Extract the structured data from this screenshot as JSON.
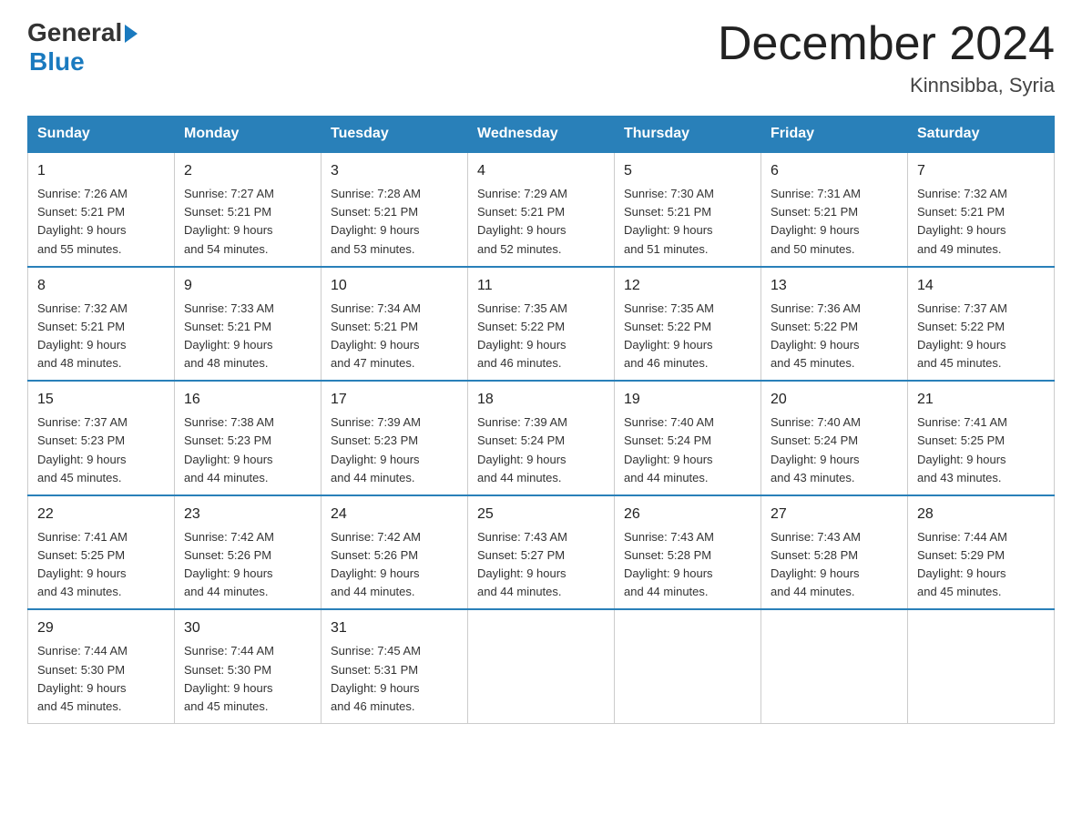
{
  "logo": {
    "general": "General",
    "blue": "Blue"
  },
  "title": "December 2024",
  "location": "Kinnsibba, Syria",
  "days_of_week": [
    "Sunday",
    "Monday",
    "Tuesday",
    "Wednesday",
    "Thursday",
    "Friday",
    "Saturday"
  ],
  "weeks": [
    [
      {
        "day": "1",
        "sunrise": "Sunrise: 7:26 AM",
        "sunset": "Sunset: 5:21 PM",
        "daylight": "Daylight: 9 hours",
        "daylight2": "and 55 minutes."
      },
      {
        "day": "2",
        "sunrise": "Sunrise: 7:27 AM",
        "sunset": "Sunset: 5:21 PM",
        "daylight": "Daylight: 9 hours",
        "daylight2": "and 54 minutes."
      },
      {
        "day": "3",
        "sunrise": "Sunrise: 7:28 AM",
        "sunset": "Sunset: 5:21 PM",
        "daylight": "Daylight: 9 hours",
        "daylight2": "and 53 minutes."
      },
      {
        "day": "4",
        "sunrise": "Sunrise: 7:29 AM",
        "sunset": "Sunset: 5:21 PM",
        "daylight": "Daylight: 9 hours",
        "daylight2": "and 52 minutes."
      },
      {
        "day": "5",
        "sunrise": "Sunrise: 7:30 AM",
        "sunset": "Sunset: 5:21 PM",
        "daylight": "Daylight: 9 hours",
        "daylight2": "and 51 minutes."
      },
      {
        "day": "6",
        "sunrise": "Sunrise: 7:31 AM",
        "sunset": "Sunset: 5:21 PM",
        "daylight": "Daylight: 9 hours",
        "daylight2": "and 50 minutes."
      },
      {
        "day": "7",
        "sunrise": "Sunrise: 7:32 AM",
        "sunset": "Sunset: 5:21 PM",
        "daylight": "Daylight: 9 hours",
        "daylight2": "and 49 minutes."
      }
    ],
    [
      {
        "day": "8",
        "sunrise": "Sunrise: 7:32 AM",
        "sunset": "Sunset: 5:21 PM",
        "daylight": "Daylight: 9 hours",
        "daylight2": "and 48 minutes."
      },
      {
        "day": "9",
        "sunrise": "Sunrise: 7:33 AM",
        "sunset": "Sunset: 5:21 PM",
        "daylight": "Daylight: 9 hours",
        "daylight2": "and 48 minutes."
      },
      {
        "day": "10",
        "sunrise": "Sunrise: 7:34 AM",
        "sunset": "Sunset: 5:21 PM",
        "daylight": "Daylight: 9 hours",
        "daylight2": "and 47 minutes."
      },
      {
        "day": "11",
        "sunrise": "Sunrise: 7:35 AM",
        "sunset": "Sunset: 5:22 PM",
        "daylight": "Daylight: 9 hours",
        "daylight2": "and 46 minutes."
      },
      {
        "day": "12",
        "sunrise": "Sunrise: 7:35 AM",
        "sunset": "Sunset: 5:22 PM",
        "daylight": "Daylight: 9 hours",
        "daylight2": "and 46 minutes."
      },
      {
        "day": "13",
        "sunrise": "Sunrise: 7:36 AM",
        "sunset": "Sunset: 5:22 PM",
        "daylight": "Daylight: 9 hours",
        "daylight2": "and 45 minutes."
      },
      {
        "day": "14",
        "sunrise": "Sunrise: 7:37 AM",
        "sunset": "Sunset: 5:22 PM",
        "daylight": "Daylight: 9 hours",
        "daylight2": "and 45 minutes."
      }
    ],
    [
      {
        "day": "15",
        "sunrise": "Sunrise: 7:37 AM",
        "sunset": "Sunset: 5:23 PM",
        "daylight": "Daylight: 9 hours",
        "daylight2": "and 45 minutes."
      },
      {
        "day": "16",
        "sunrise": "Sunrise: 7:38 AM",
        "sunset": "Sunset: 5:23 PM",
        "daylight": "Daylight: 9 hours",
        "daylight2": "and 44 minutes."
      },
      {
        "day": "17",
        "sunrise": "Sunrise: 7:39 AM",
        "sunset": "Sunset: 5:23 PM",
        "daylight": "Daylight: 9 hours",
        "daylight2": "and 44 minutes."
      },
      {
        "day": "18",
        "sunrise": "Sunrise: 7:39 AM",
        "sunset": "Sunset: 5:24 PM",
        "daylight": "Daylight: 9 hours",
        "daylight2": "and 44 minutes."
      },
      {
        "day": "19",
        "sunrise": "Sunrise: 7:40 AM",
        "sunset": "Sunset: 5:24 PM",
        "daylight": "Daylight: 9 hours",
        "daylight2": "and 44 minutes."
      },
      {
        "day": "20",
        "sunrise": "Sunrise: 7:40 AM",
        "sunset": "Sunset: 5:24 PM",
        "daylight": "Daylight: 9 hours",
        "daylight2": "and 43 minutes."
      },
      {
        "day": "21",
        "sunrise": "Sunrise: 7:41 AM",
        "sunset": "Sunset: 5:25 PM",
        "daylight": "Daylight: 9 hours",
        "daylight2": "and 43 minutes."
      }
    ],
    [
      {
        "day": "22",
        "sunrise": "Sunrise: 7:41 AM",
        "sunset": "Sunset: 5:25 PM",
        "daylight": "Daylight: 9 hours",
        "daylight2": "and 43 minutes."
      },
      {
        "day": "23",
        "sunrise": "Sunrise: 7:42 AM",
        "sunset": "Sunset: 5:26 PM",
        "daylight": "Daylight: 9 hours",
        "daylight2": "and 44 minutes."
      },
      {
        "day": "24",
        "sunrise": "Sunrise: 7:42 AM",
        "sunset": "Sunset: 5:26 PM",
        "daylight": "Daylight: 9 hours",
        "daylight2": "and 44 minutes."
      },
      {
        "day": "25",
        "sunrise": "Sunrise: 7:43 AM",
        "sunset": "Sunset: 5:27 PM",
        "daylight": "Daylight: 9 hours",
        "daylight2": "and 44 minutes."
      },
      {
        "day": "26",
        "sunrise": "Sunrise: 7:43 AM",
        "sunset": "Sunset: 5:28 PM",
        "daylight": "Daylight: 9 hours",
        "daylight2": "and 44 minutes."
      },
      {
        "day": "27",
        "sunrise": "Sunrise: 7:43 AM",
        "sunset": "Sunset: 5:28 PM",
        "daylight": "Daylight: 9 hours",
        "daylight2": "and 44 minutes."
      },
      {
        "day": "28",
        "sunrise": "Sunrise: 7:44 AM",
        "sunset": "Sunset: 5:29 PM",
        "daylight": "Daylight: 9 hours",
        "daylight2": "and 45 minutes."
      }
    ],
    [
      {
        "day": "29",
        "sunrise": "Sunrise: 7:44 AM",
        "sunset": "Sunset: 5:30 PM",
        "daylight": "Daylight: 9 hours",
        "daylight2": "and 45 minutes."
      },
      {
        "day": "30",
        "sunrise": "Sunrise: 7:44 AM",
        "sunset": "Sunset: 5:30 PM",
        "daylight": "Daylight: 9 hours",
        "daylight2": "and 45 minutes."
      },
      {
        "day": "31",
        "sunrise": "Sunrise: 7:45 AM",
        "sunset": "Sunset: 5:31 PM",
        "daylight": "Daylight: 9 hours",
        "daylight2": "and 46 minutes."
      },
      {
        "day": "",
        "sunrise": "",
        "sunset": "",
        "daylight": "",
        "daylight2": ""
      },
      {
        "day": "",
        "sunrise": "",
        "sunset": "",
        "daylight": "",
        "daylight2": ""
      },
      {
        "day": "",
        "sunrise": "",
        "sunset": "",
        "daylight": "",
        "daylight2": ""
      },
      {
        "day": "",
        "sunrise": "",
        "sunset": "",
        "daylight": "",
        "daylight2": ""
      }
    ]
  ]
}
